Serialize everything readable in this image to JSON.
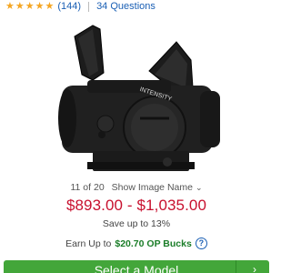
{
  "rating": {
    "stars": 5,
    "count_label": "(144)",
    "questions_label": "34 Questions",
    "star_color": "#f5a623"
  },
  "image_meta": {
    "position_label": "11 of 20",
    "show_name_label": "Show Image Name"
  },
  "product_image": {
    "dial_text": "INTENSITY"
  },
  "pricing": {
    "price_range": "$893.00 - $1,035.00",
    "save_label": "Save up to 13%",
    "price_color": "#c8102e"
  },
  "bucks": {
    "prefix": "Earn Up to",
    "amount": "$20.70 OP Bucks"
  },
  "cta": {
    "label": "Select a Model",
    "color": "#43a63a"
  },
  "icons": [
    "star-icon",
    "chevron-down-icon",
    "help-icon",
    "arrow-right-icon"
  ]
}
